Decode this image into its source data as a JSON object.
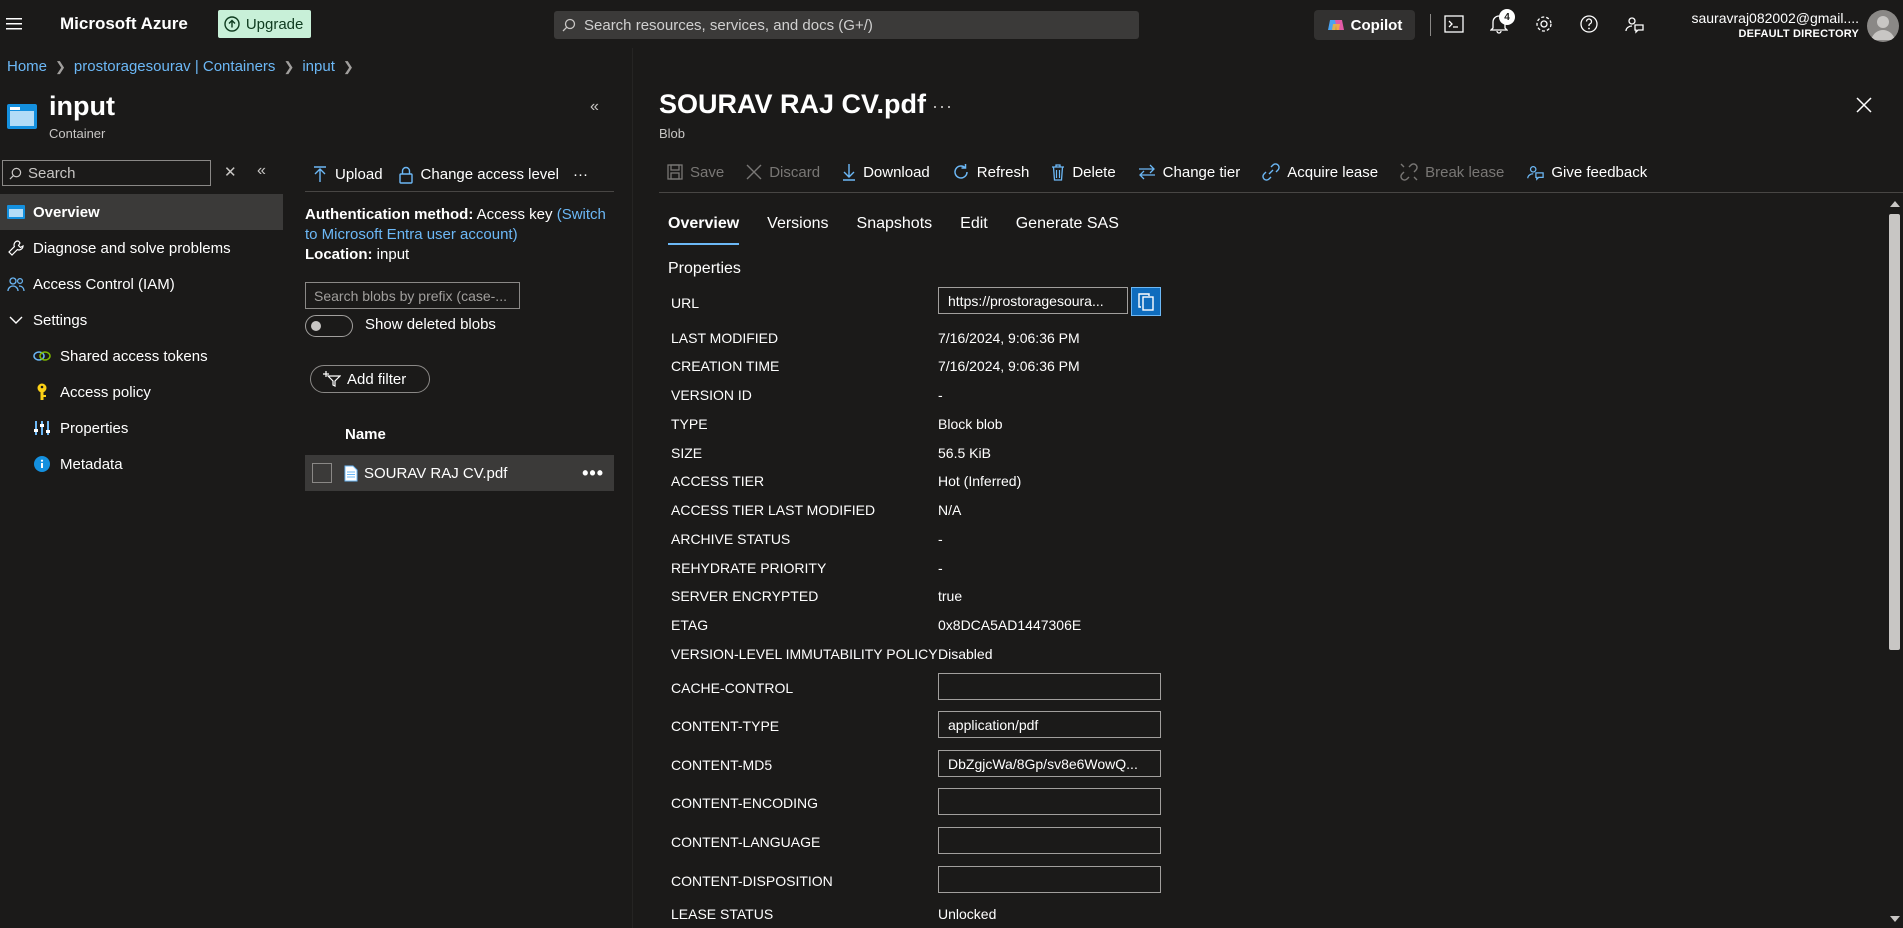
{
  "topbar": {
    "brand": "Microsoft Azure",
    "upgrade_label": "Upgrade",
    "search_placeholder": "Search resources, services, and docs (G+/)",
    "copilot_label": "Copilot",
    "notification_count": "4",
    "account_email": "sauravraj082002@gmail....",
    "account_directory": "DEFAULT DIRECTORY"
  },
  "breadcrumb": [
    "Home",
    "prostoragesourav | Containers",
    "input"
  ],
  "container": {
    "title": "input",
    "subtitle": "Container"
  },
  "nav": {
    "search_placeholder": "Search",
    "items": [
      {
        "label": "Overview",
        "icon": "overview-icon",
        "active": true
      },
      {
        "label": "Diagnose and solve problems",
        "icon": "wrench-icon"
      },
      {
        "label": "Access Control (IAM)",
        "icon": "people-icon"
      },
      {
        "label": "Settings",
        "icon": "chevron-down-icon"
      },
      {
        "label": "Shared access tokens",
        "icon": "link-icon"
      },
      {
        "label": "Access policy",
        "icon": "key-icon"
      },
      {
        "label": "Properties",
        "icon": "properties-icon"
      },
      {
        "label": "Metadata",
        "icon": "info-icon"
      }
    ]
  },
  "middle": {
    "toolbar": {
      "upload": "Upload",
      "change_access": "Change access level",
      "more": "···"
    },
    "auth_method_label": "Authentication method:",
    "auth_method_value": "Access key",
    "auth_switch_link": "(Switch to Microsoft Entra user account)",
    "location_label": "Location:",
    "location_value": "input",
    "blob_search_placeholder": "Search blobs by prefix (case-...",
    "show_deleted_label": "Show deleted blobs",
    "add_filter_label": "Add filter",
    "column_name": "Name",
    "blobs": [
      {
        "name": "SOURAV RAJ CV.pdf"
      }
    ]
  },
  "blob": {
    "title": "SOURAV RAJ CV.pdf",
    "subtitle": "Blob",
    "title_more": "···",
    "commands": {
      "save": "Save",
      "discard": "Discard",
      "download": "Download",
      "refresh": "Refresh",
      "delete": "Delete",
      "change_tier": "Change tier",
      "acquire_lease": "Acquire lease",
      "break_lease": "Break lease",
      "give_feedback": "Give feedback"
    },
    "tabs": [
      "Overview",
      "Versions",
      "Snapshots",
      "Edit",
      "Generate SAS"
    ],
    "properties_heading": "Properties",
    "properties": {
      "url_label": "URL",
      "url_value": "https://prostoragesoura...",
      "last_modified_label": "LAST MODIFIED",
      "last_modified_value": "7/16/2024, 9:06:36 PM",
      "creation_time_label": "CREATION TIME",
      "creation_time_value": "7/16/2024, 9:06:36 PM",
      "version_id_label": "VERSION ID",
      "version_id_value": "-",
      "type_label": "TYPE",
      "type_value": "Block blob",
      "size_label": "SIZE",
      "size_value": "56.5 KiB",
      "access_tier_label": "ACCESS TIER",
      "access_tier_value": "Hot (Inferred)",
      "access_tier_lm_label": "ACCESS TIER LAST MODIFIED",
      "access_tier_lm_value": "N/A",
      "archive_status_label": "ARCHIVE STATUS",
      "archive_status_value": "-",
      "rehydrate_priority_label": "REHYDRATE PRIORITY",
      "rehydrate_priority_value": "-",
      "server_encrypted_label": "SERVER ENCRYPTED",
      "server_encrypted_value": "true",
      "etag_label": "ETAG",
      "etag_value": "0x8DCA5AD1447306E",
      "immutability_label": "VERSION-LEVEL IMMUTABILITY POLICY",
      "immutability_value": "Disabled",
      "cache_control_label": "CACHE-CONTROL",
      "cache_control_value": "",
      "content_type_label": "CONTENT-TYPE",
      "content_type_value": "application/pdf",
      "content_md5_label": "CONTENT-MD5",
      "content_md5_value": "DbZgjcWa/8Gp/sv8e6WowQ...",
      "content_encoding_label": "CONTENT-ENCODING",
      "content_encoding_value": "",
      "content_language_label": "CONTENT-LANGUAGE",
      "content_language_value": "",
      "content_disposition_label": "CONTENT-DISPOSITION",
      "content_disposition_value": "",
      "lease_status_label": "LEASE STATUS",
      "lease_status_value": "Unlocked"
    }
  },
  "colors": {
    "background": "#1b1a19",
    "accent": "#0f6cbd",
    "link": "#6cb8f6",
    "upgrade_bg": "#c8f0d8",
    "selected_row": "#3b3a39"
  }
}
